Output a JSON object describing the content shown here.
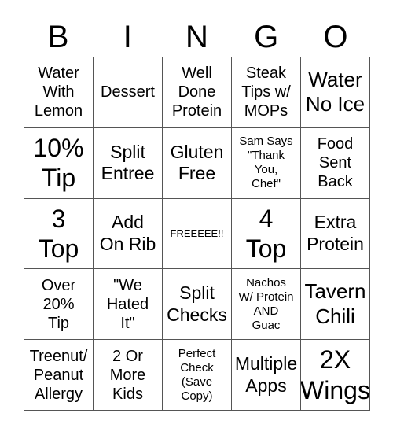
{
  "title_letters": [
    "B",
    "I",
    "N",
    "G",
    "O"
  ],
  "cells": [
    [
      {
        "text": "Water\nWith\nLemon",
        "size": "s20"
      },
      {
        "text": "Dessert",
        "size": "s20"
      },
      {
        "text": "Well\nDone\nProtein",
        "size": "s20"
      },
      {
        "text": "Steak\nTips w/\nMOPs",
        "size": "s20"
      },
      {
        "text": "Water\nNo Ice",
        "size": "s26"
      }
    ],
    [
      {
        "text": "10%\nTip",
        "size": "s30"
      },
      {
        "text": "Split\nEntree",
        "size": "s23"
      },
      {
        "text": "Gluten\nFree",
        "size": "s23"
      },
      {
        "text": "Sam Says\n\"Thank\nYou,\nChef\"",
        "size": "s15"
      },
      {
        "text": "Food\nSent\nBack",
        "size": "s20"
      }
    ],
    [
      {
        "text": "3\nTop",
        "size": "s30"
      },
      {
        "text": "Add\nOn Rib",
        "size": "s23"
      },
      {
        "text": "FREEEEE!!",
        "size": "s13"
      },
      {
        "text": "4\nTop",
        "size": "s30"
      },
      {
        "text": "Extra\nProtein",
        "size": "s23"
      }
    ],
    [
      {
        "text": "Over\n20%\nTip",
        "size": "s20"
      },
      {
        "text": "\"We\nHated\nIt\"",
        "size": "s20"
      },
      {
        "text": "Split\nChecks",
        "size": "s23"
      },
      {
        "text": "Nachos\nW/ Protein\nAND\nGuac",
        "size": "s15"
      },
      {
        "text": "Tavern\nChili",
        "size": "s26"
      }
    ],
    [
      {
        "text": "Treenut/\nPeanut\nAllergy",
        "size": "s20"
      },
      {
        "text": "2 Or\nMore\nKids",
        "size": "s20"
      },
      {
        "text": "Perfect\nCheck\n(Save\nCopy)",
        "size": "s15"
      },
      {
        "text": "Multiple\nApps",
        "size": "s23"
      },
      {
        "text": "2X\nWings",
        "size": "s30"
      }
    ]
  ]
}
